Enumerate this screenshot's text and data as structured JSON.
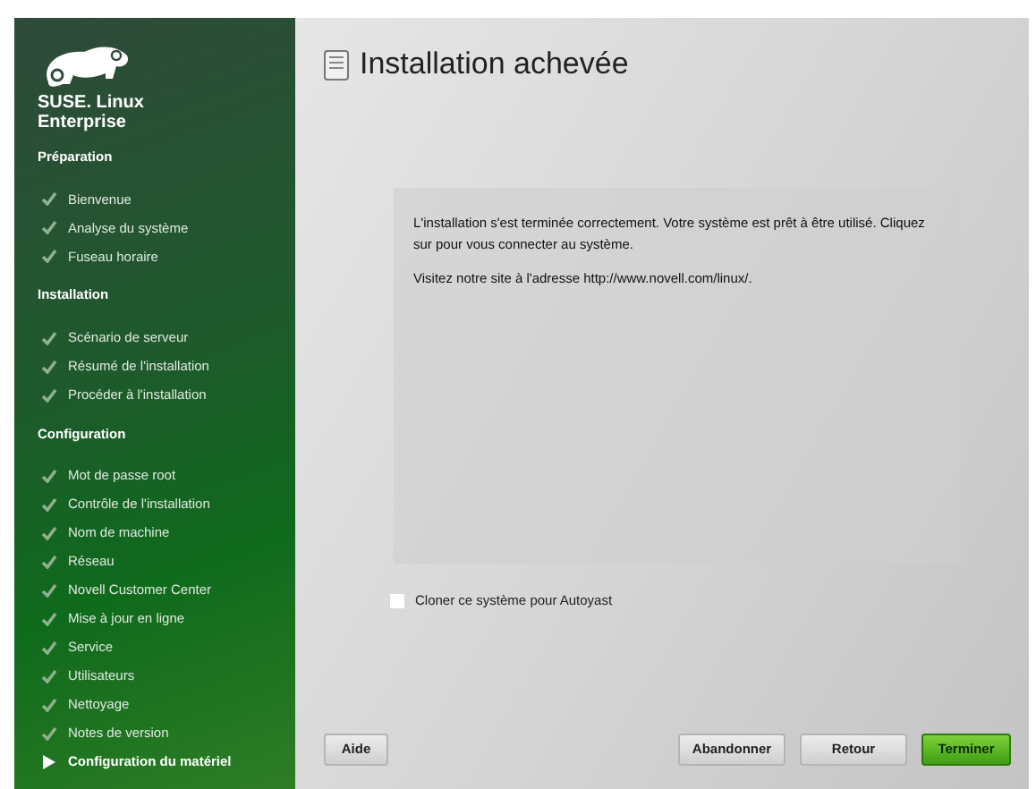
{
  "sidebar": {
    "brand": "SUSE. Linux Enterprise",
    "sections": [
      {
        "heading": "Préparation",
        "steps": [
          {
            "label": "Bienvenue",
            "kind": "done"
          },
          {
            "label": "Analyse du système",
            "kind": "done"
          },
          {
            "label": "Fuseau horaire",
            "kind": "done"
          }
        ]
      },
      {
        "heading": "Installation",
        "steps": [
          {
            "label": "Scénario de serveur",
            "kind": "done"
          },
          {
            "label": "Résumé de l'installation",
            "kind": "done"
          },
          {
            "label": "Procéder à l'installation",
            "kind": "done"
          }
        ]
      },
      {
        "heading": "Configuration",
        "steps": [
          {
            "label": "Mot de passe root",
            "kind": "done"
          },
          {
            "label": "Contrôle de l'installation",
            "kind": "done"
          },
          {
            "label": "Nom de machine",
            "kind": "done"
          },
          {
            "label": "Réseau",
            "kind": "done"
          },
          {
            "label": "Novell Customer Center",
            "kind": "done"
          },
          {
            "label": "Mise à jour en ligne",
            "kind": "done"
          },
          {
            "label": "Service",
            "kind": "done"
          },
          {
            "label": "Utilisateurs",
            "kind": "done"
          },
          {
            "label": "Nettoyage",
            "kind": "done"
          },
          {
            "label": "Notes de version",
            "kind": "done"
          },
          {
            "label": "Configuration du matériel",
            "kind": "current"
          }
        ]
      }
    ]
  },
  "page": {
    "title": "Installation achevée",
    "paragraphs": [
      "L'installation s'est terminée correctement. Votre système est prêt à être utilisé. Cliquez sur pour vous connecter au système.",
      "Visitez notre site à l'adresse http://www.novell.com/linux/."
    ],
    "clone_checkbox": {
      "label": "Cloner ce système pour Autoyast",
      "checked": false
    }
  },
  "buttons": [
    {
      "label": "Aide",
      "kind": "help"
    },
    {
      "label": "Abandonner",
      "kind": "normal"
    },
    {
      "label": "Retour",
      "kind": "normal"
    },
    {
      "label": "Terminer",
      "kind": "primary"
    }
  ]
}
